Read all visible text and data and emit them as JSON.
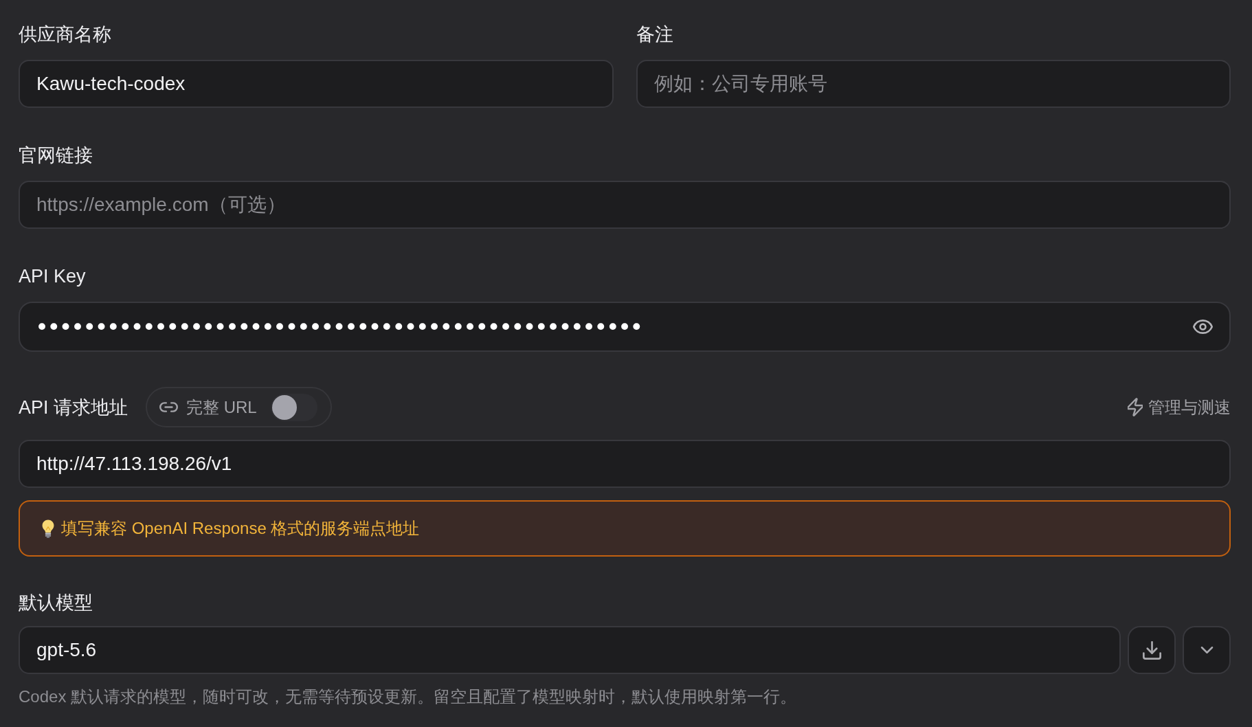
{
  "provider_name": {
    "label": "供应商名称",
    "value": "Kawu-tech-codex"
  },
  "note": {
    "label": "备注",
    "placeholder": "例如：公司专用账号"
  },
  "website": {
    "label": "官网链接",
    "placeholder": "https://example.com（可选）"
  },
  "api_key": {
    "label": "API Key",
    "value": "•••••••••••••••••••••••••••••••••••••••••••••••••••"
  },
  "api_url": {
    "label": "API 请求地址",
    "full_url_toggle": {
      "label": "完整 URL",
      "on": false
    },
    "manage_link": "管理与测速",
    "value": "http://47.113.198.26/v1",
    "tip": "填写兼容 OpenAI Response 格式的服务端点地址"
  },
  "default_model": {
    "label": "默认模型",
    "value": "gpt-5.6",
    "hint": "Codex 默认请求的模型，随时可改，无需等待预设更新。留空且配置了模型映射时，默认使用映射第一行。"
  }
}
